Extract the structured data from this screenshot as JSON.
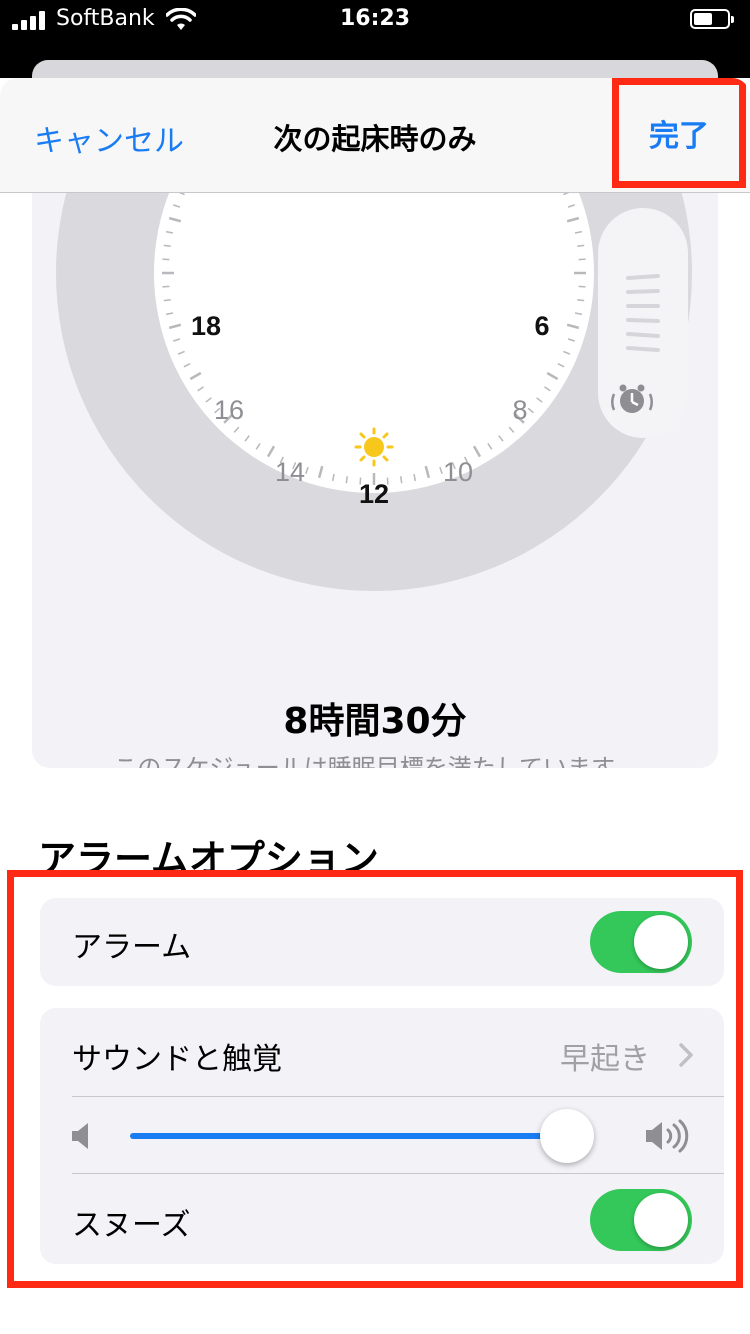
{
  "status_bar": {
    "carrier": "SoftBank",
    "time": "16:23"
  },
  "nav": {
    "cancel_label": "キャンセル",
    "title": "次の起床時のみ",
    "done_label": "完了"
  },
  "clock": {
    "hour_labels": [
      "18",
      "6",
      "16",
      "8",
      "14",
      "10",
      "12"
    ],
    "duration": "8時間30分",
    "goal_text": "このスケジュールは睡眠目標を満たしています。"
  },
  "alarm_options": {
    "section_title": "アラームオプション",
    "alarm_label": "アラーム",
    "alarm_on": true,
    "sound_label": "サウンドと触覚",
    "sound_value": "早起き",
    "volume_level": 0.93,
    "snooze_label": "スヌーズ",
    "snooze_on": true
  },
  "colors": {
    "accent": "#1a7cf3",
    "toggle_on": "#34c759",
    "highlight": "#ff2a13",
    "sun": "#f7c71b"
  },
  "icons": [
    "signal-icon",
    "wifi-icon",
    "battery-icon",
    "sun-icon",
    "alarm-clock-icon",
    "volume-low-icon",
    "volume-high-icon",
    "chevron-right-icon"
  ]
}
